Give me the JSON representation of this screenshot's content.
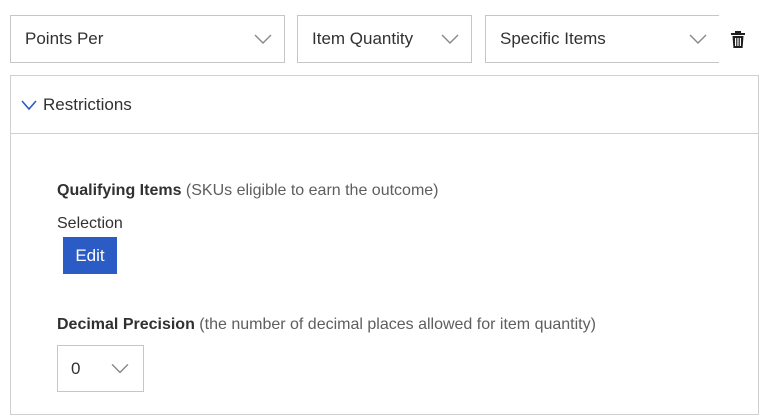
{
  "top_row": {
    "points_per": {
      "value": "Points Per"
    },
    "item_quantity": {
      "value": "Item Quantity"
    },
    "specific_items": {
      "value": "Specific Items"
    }
  },
  "restrictions": {
    "title": "Restrictions",
    "expanded": true,
    "qualifying_items": {
      "label": "Qualifying Items",
      "hint": "(SKUs eligible to earn the outcome)"
    },
    "selection_label": "Selection",
    "edit_label": "Edit",
    "decimal_precision": {
      "label": "Decimal Precision",
      "hint": "(the number of decimal places allowed for item quantity)",
      "value": "0"
    }
  },
  "colors": {
    "accent": "#2b5bc4",
    "border": "#c8c6c4",
    "text": "#323130",
    "hint_text": "#605e5c"
  },
  "icons": {
    "dropdown": "chevron-down-icon",
    "delete": "trash-icon",
    "collapse": "chevron-down-icon"
  }
}
